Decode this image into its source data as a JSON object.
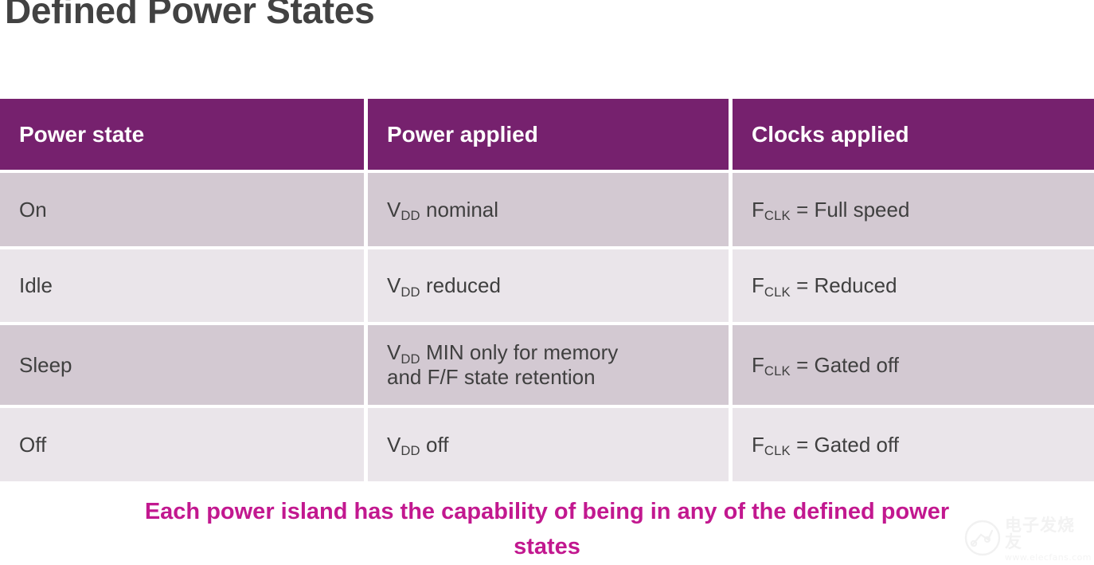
{
  "slide": {
    "title": "Defined Power States"
  },
  "table": {
    "headers": [
      "Power state",
      "Power applied",
      "Clocks applied"
    ],
    "rows": [
      {
        "state": "On",
        "power_applied": {
          "symbol": "V",
          "subscript": "DD",
          "text": " nominal"
        },
        "clocks_applied": {
          "symbol": "F",
          "subscript": "CLK",
          "text": " = Full speed"
        }
      },
      {
        "state": "Idle",
        "power_applied": {
          "symbol": "V",
          "subscript": "DD",
          "text": " reduced"
        },
        "clocks_applied": {
          "symbol": "F",
          "subscript": "CLK",
          "text": " = Reduced"
        }
      },
      {
        "state": "Sleep",
        "power_applied": {
          "symbol": "V",
          "subscript": "DD",
          "text": " MIN only for memory\nand F/F state retention"
        },
        "clocks_applied": {
          "symbol": "F",
          "subscript": "CLK",
          "text": " = Gated off"
        }
      },
      {
        "state": "Off",
        "power_applied": {
          "symbol": "V",
          "subscript": "DD",
          "text": " off"
        },
        "clocks_applied": {
          "symbol": "F",
          "subscript": "CLK",
          "text": " = Gated off"
        }
      }
    ]
  },
  "caption": {
    "text": "Each power island has the capability of being in any of the defined power states"
  },
  "watermark": {
    "cn": "电子发烧友",
    "url": "www.elecfans.com"
  },
  "colors": {
    "header_bg": "#76216E",
    "row_dark": "#d3c9d2",
    "row_light": "#eae5ea",
    "title": "#424242",
    "caption": "#C2188F",
    "body_text": "#3f3f3f"
  }
}
